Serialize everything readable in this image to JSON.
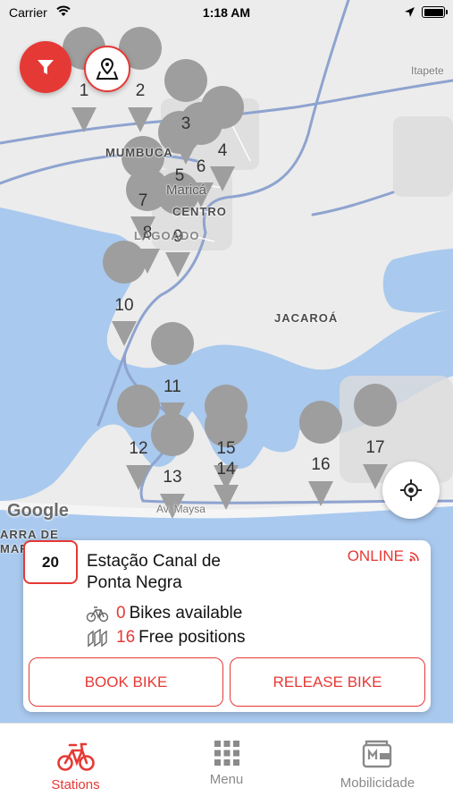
{
  "status_bar": {
    "carrier": "Carrier",
    "time": "1:18 AM"
  },
  "map": {
    "labels": {
      "itapeteiu": "Itapete",
      "mumbuca": "MUMBUCA",
      "marica": "Maricá",
      "centro": "CENTRO",
      "flamengo": "LAGOADO",
      "jacaroa": "JACAROÁ",
      "av_maysa": "Av. Maysa",
      "barra_de_marica": "ARRA DE",
      "barra_de_marica_2": "MAR",
      "google": "Google"
    },
    "markers": [
      "1",
      "2",
      "3",
      "4",
      "5",
      "6",
      "7",
      "8",
      "9",
      "10",
      "11",
      "12",
      "13",
      "14",
      "15",
      "16",
      "17"
    ]
  },
  "station": {
    "number": "20",
    "name_line1": "Estação Canal de",
    "name_line2": "Ponta Negra",
    "status": "ONLINE",
    "bikes_count": "0",
    "bikes_label": "Bikes available",
    "positions_count": "16",
    "positions_label": "Free positions",
    "book_label": "BOOK BIKE",
    "release_label": "RELEASE BIKE"
  },
  "tabs": {
    "stations": "Stations",
    "menu": "Menu",
    "mobilidade": "Mobilicidade"
  },
  "colors": {
    "accent": "#e53935",
    "water": "#a9c9ee",
    "land": "#ececec",
    "road": "#8ea3cf",
    "marker": "#9e9e9e"
  }
}
